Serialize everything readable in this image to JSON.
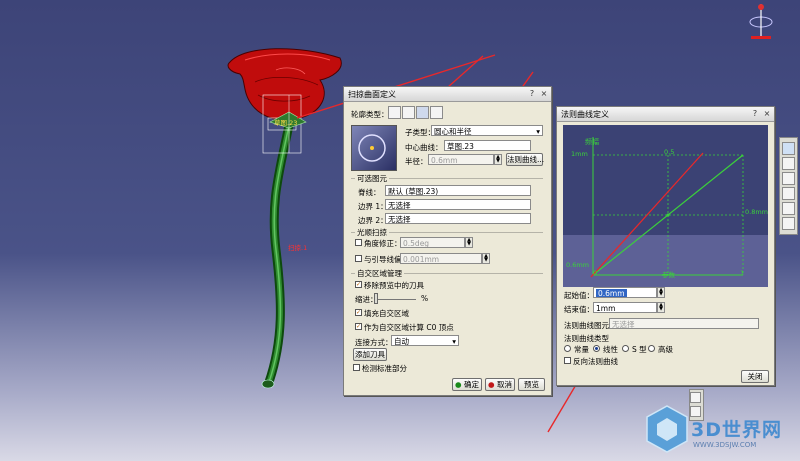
{
  "sweep_dialog": {
    "title": "扫掠曲面定义",
    "profile_type_label": "轮廓类型：",
    "subtype_label": "子类型：",
    "subtype_value": "圆心和半径",
    "center_curve_label": "中心曲线：",
    "center_curve_value": "草图.23",
    "radius_label": "半径：",
    "radius_value": "0.6mm",
    "law_curve_button": "法则曲线...",
    "optional_section": "可选图元",
    "spine_label": "脊线：",
    "spine_value": "默认 (草图.23)",
    "boundary1_label": "边界 1：",
    "boundary1_value": "无选择",
    "boundary2_label": "边界 2：",
    "boundary2_value": "无选择",
    "smooth_section": "光顺扫掠",
    "angle_correction_label": "角度修正：",
    "angle_correction_value": "0.5deg",
    "guide_deviation_label": "与引导线偏差：",
    "guide_deviation_value": "0.001mm",
    "self_intersection_section": "自交区域管理",
    "remove_preview_label": "移除预览中的刀具",
    "taper_label": "缩进：",
    "taper_unit": "%",
    "fill_label": "填充自交区域",
    "c0_label": "作为自交区域计算 C0 顶点",
    "connection_label": "连接方式：",
    "connection_value": "自动",
    "add_tool_button": "添加刀具",
    "canonical_label": "检测标准部分",
    "ok_button": "确定",
    "cancel_button": "取消",
    "preview_button": "预览"
  },
  "law_dialog": {
    "title": "法则曲线定义",
    "graph_title": "频幅",
    "y_bottom": "0.6mm",
    "y_top": "1mm",
    "y_right": "0.8mm",
    "x_mid": "0.5",
    "x_left": "0",
    "x_right": "1",
    "x_axis_label": "参数",
    "start_label": "起始值：",
    "start_value": "0.6mm",
    "end_label": "结束值：",
    "end_value": "1mm",
    "law_element_label": "法则曲线图元：",
    "law_element_value": "无选择",
    "law_type_label": "法则曲线类型",
    "law_types": [
      "常量",
      "线性",
      "S 型",
      "高级"
    ],
    "reverse_label": "反向法则曲线",
    "close_button": "关闭"
  },
  "viewport": {
    "rose_annotation": "草图.23",
    "tube_annotation": "扫掠.1"
  },
  "watermark": {
    "brand": "3D世界网",
    "url": "WWW.3DSJW.COM"
  },
  "colors": {
    "accent_arrow": "#e8282a",
    "law_graph_bg": "#3b4274",
    "law_graph_line": "#3bd13b"
  }
}
